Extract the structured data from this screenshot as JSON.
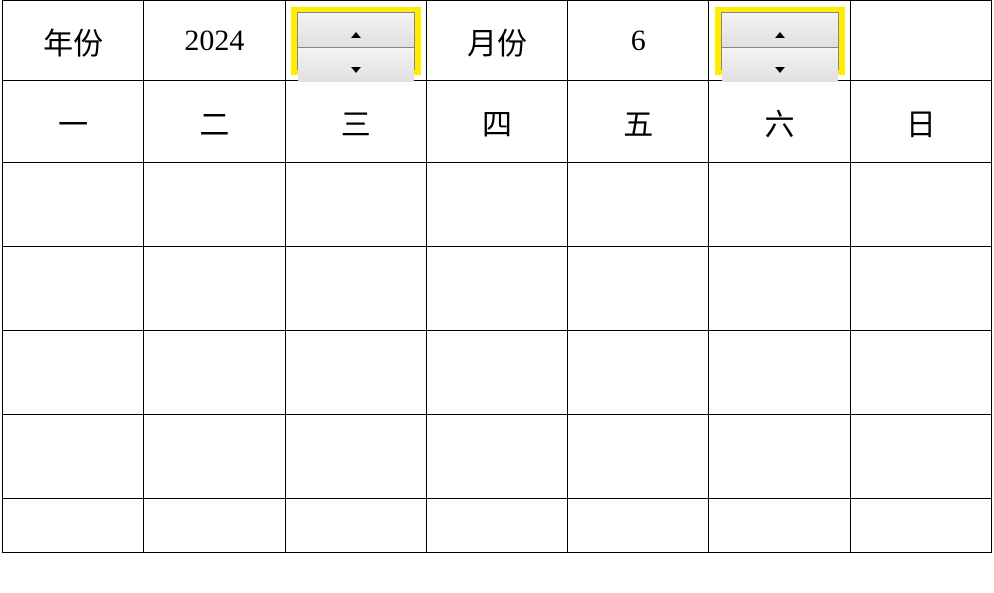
{
  "header": {
    "year_label": "年份",
    "year_value": "2024",
    "month_label": "月份",
    "month_value": "6"
  },
  "weekdays": {
    "d1": "一",
    "d2": "二",
    "d3": "三",
    "d4": "四",
    "d5": "五",
    "d6": "六",
    "d7": "日"
  },
  "grid": {
    "r1": {
      "c1": "",
      "c2": "",
      "c3": "",
      "c4": "",
      "c5": "",
      "c6": "",
      "c7": ""
    },
    "r2": {
      "c1": "",
      "c2": "",
      "c3": "",
      "c4": "",
      "c5": "",
      "c6": "",
      "c7": ""
    },
    "r3": {
      "c1": "",
      "c2": "",
      "c3": "",
      "c4": "",
      "c5": "",
      "c6": "",
      "c7": ""
    },
    "r4": {
      "c1": "",
      "c2": "",
      "c3": "",
      "c4": "",
      "c5": "",
      "c6": "",
      "c7": ""
    },
    "r5": {
      "c1": "",
      "c2": "",
      "c3": "",
      "c4": "",
      "c5": "",
      "c6": "",
      "c7": ""
    }
  }
}
